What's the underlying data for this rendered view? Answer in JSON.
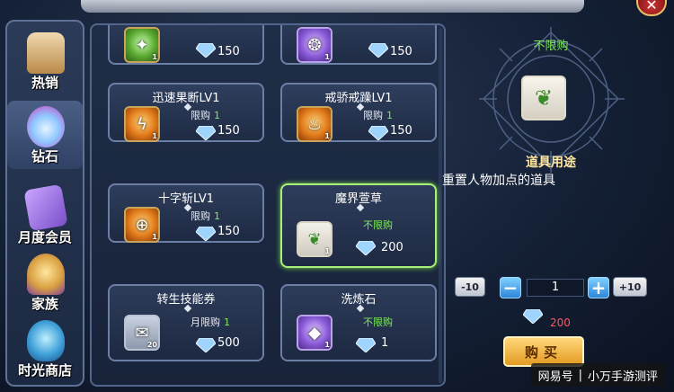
{
  "window": {
    "close_icon": "close-icon"
  },
  "sidebar": {
    "items": [
      {
        "label": "热销",
        "icon": "bag-icon",
        "active": false
      },
      {
        "label": "钻石",
        "icon": "diamond-pile-icon",
        "active": true
      },
      {
        "label": "月度会员",
        "icon": "card-icon",
        "active": false
      },
      {
        "label": "家族",
        "icon": "crest-icon",
        "active": false
      },
      {
        "label": "时光商店",
        "icon": "shield-icon",
        "active": false
      }
    ]
  },
  "shop": {
    "top_row": [
      {
        "price": "150",
        "count": "1",
        "icon": "green-skill-icon"
      },
      {
        "price": "150",
        "count": "1",
        "icon": "red-skill-icon"
      }
    ],
    "items": [
      {
        "name": "迅速果断LV1",
        "limit_label": "限购",
        "limit_value": "1",
        "price": "150",
        "count": "1",
        "icon": "swift-skill-icon"
      },
      {
        "name": "戒骄戒躁LV1",
        "limit_label": "限购",
        "limit_value": "1",
        "price": "150",
        "count": "1",
        "icon": "calm-skill-icon"
      },
      {
        "name": "十字斩LV1",
        "limit_label": "限购",
        "limit_value": "1",
        "price": "150",
        "count": "1",
        "icon": "cross-slash-icon"
      },
      {
        "name": "魔界萱草",
        "limit_label": "不限购",
        "limit_value": "",
        "price": "200",
        "count": "1",
        "icon": "herb-icon"
      },
      {
        "name": "转生技能券",
        "limit_label": "月限购",
        "limit_value": "1",
        "price": "500",
        "count": "20",
        "icon": "scroll-icon"
      },
      {
        "name": "洗炼石",
        "limit_label": "不限购",
        "limit_value": "",
        "price": "1",
        "count": "1",
        "icon": "purple-gem-icon"
      }
    ]
  },
  "detail": {
    "limit_text": "不限购",
    "item_icon": "herb-icon",
    "usage_title": "道具用途",
    "usage_desc": "重置人物加点的道具",
    "minus10": "-10",
    "plus10": "+10",
    "minus": "−",
    "plus": "+",
    "quantity": "1",
    "total": "200",
    "buy_label": "购买"
  },
  "colors": {
    "accent_green": "#7fea5a",
    "price_red": "#ff5757",
    "selected_border": "#a7f07a"
  },
  "watermark": {
    "left": "网易号",
    "right": "小万手游测评"
  }
}
